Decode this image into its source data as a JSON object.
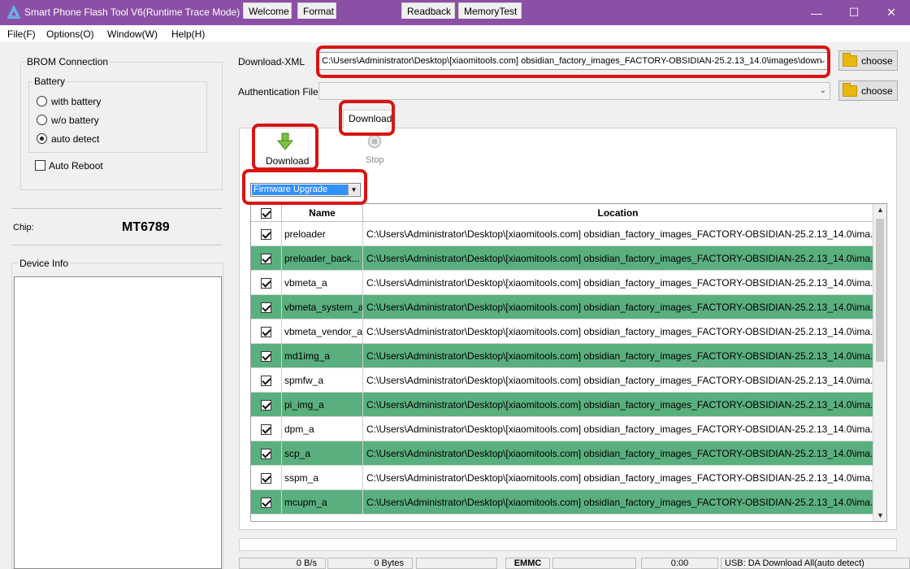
{
  "window": {
    "title": "Smart Phone Flash Tool V6(Runtime Trace Mode)",
    "minimize_glyph": "—",
    "maximize_glyph": "☐",
    "close_glyph": "✕"
  },
  "menu": {
    "items": [
      "File(F)",
      "Options(O)",
      "Window(W)",
      "Help(H)"
    ]
  },
  "left": {
    "brom_label": "BROM Connection",
    "battery_label": "Battery",
    "battery_options": [
      {
        "label": "with battery",
        "checked": false
      },
      {
        "label": "w/o battery",
        "checked": false
      },
      {
        "label": "auto detect",
        "checked": true
      }
    ],
    "auto_reboot_label": "Auto Reboot",
    "auto_reboot_checked": false,
    "chip_label": "Chip:",
    "chip_value": "MT6789",
    "device_info_label": "Device Info"
  },
  "download_xml": {
    "label": "Download-XML",
    "value": "C:\\Users\\Administrator\\Desktop\\[xiaomitools.com] obsidian_factory_images_FACTORY-OBSIDIAN-25.2.13_14.0\\images\\down",
    "choose_label": "choose"
  },
  "auth_file": {
    "label": "Authentication File",
    "value": "",
    "choose_label": "choose"
  },
  "tabs": [
    {
      "label": "Welcome",
      "active": false
    },
    {
      "label": "Format",
      "active": false
    },
    {
      "label": "Download",
      "active": true
    },
    {
      "label": "Readback",
      "active": false
    },
    {
      "label": "MemoryTest",
      "active": false
    }
  ],
  "toolbar": {
    "download_label": "Download",
    "stop_label": "Stop"
  },
  "mode_select": {
    "value": "Firmware Upgrade"
  },
  "table": {
    "headers": {
      "name": "Name",
      "location": "Location"
    },
    "rows": [
      {
        "checked": true,
        "name": "preloader",
        "location": "C:\\Users\\Administrator\\Desktop\\[xiaomitools.com] obsidian_factory_images_FACTORY-OBSIDIAN-25.2.13_14.0\\ima..."
      },
      {
        "checked": true,
        "name": "preloader_back...",
        "location": "C:\\Users\\Administrator\\Desktop\\[xiaomitools.com] obsidian_factory_images_FACTORY-OBSIDIAN-25.2.13_14.0\\ima..."
      },
      {
        "checked": true,
        "name": "vbmeta_a",
        "location": "C:\\Users\\Administrator\\Desktop\\[xiaomitools.com] obsidian_factory_images_FACTORY-OBSIDIAN-25.2.13_14.0\\ima..."
      },
      {
        "checked": true,
        "name": "vbmeta_system_a",
        "location": "C:\\Users\\Administrator\\Desktop\\[xiaomitools.com] obsidian_factory_images_FACTORY-OBSIDIAN-25.2.13_14.0\\ima..."
      },
      {
        "checked": true,
        "name": "vbmeta_vendor_a",
        "location": "C:\\Users\\Administrator\\Desktop\\[xiaomitools.com] obsidian_factory_images_FACTORY-OBSIDIAN-25.2.13_14.0\\ima..."
      },
      {
        "checked": true,
        "name": "md1img_a",
        "location": "C:\\Users\\Administrator\\Desktop\\[xiaomitools.com] obsidian_factory_images_FACTORY-OBSIDIAN-25.2.13_14.0\\ima..."
      },
      {
        "checked": true,
        "name": "spmfw_a",
        "location": "C:\\Users\\Administrator\\Desktop\\[xiaomitools.com] obsidian_factory_images_FACTORY-OBSIDIAN-25.2.13_14.0\\ima..."
      },
      {
        "checked": true,
        "name": "pi_img_a",
        "location": "C:\\Users\\Administrator\\Desktop\\[xiaomitools.com] obsidian_factory_images_FACTORY-OBSIDIAN-25.2.13_14.0\\ima..."
      },
      {
        "checked": true,
        "name": "dpm_a",
        "location": "C:\\Users\\Administrator\\Desktop\\[xiaomitools.com] obsidian_factory_images_FACTORY-OBSIDIAN-25.2.13_14.0\\ima..."
      },
      {
        "checked": true,
        "name": "scp_a",
        "location": "C:\\Users\\Administrator\\Desktop\\[xiaomitools.com] obsidian_factory_images_FACTORY-OBSIDIAN-25.2.13_14.0\\ima..."
      },
      {
        "checked": true,
        "name": "sspm_a",
        "location": "C:\\Users\\Administrator\\Desktop\\[xiaomitools.com] obsidian_factory_images_FACTORY-OBSIDIAN-25.2.13_14.0\\ima..."
      },
      {
        "checked": true,
        "name": "mcupm_a",
        "location": "C:\\Users\\Administrator\\Desktop\\[xiaomitools.com] obsidian_factory_images_FACTORY-OBSIDIAN-25.2.13_14.0\\ima..."
      }
    ]
  },
  "status": {
    "speed": "0 B/s",
    "bytes": "0 Bytes",
    "blank": "",
    "storage": "EMMC",
    "blank2": "",
    "time": "0:00",
    "usb": "USB: DA Download All(auto detect)"
  },
  "colors": {
    "titlebar": "#8c4fa6",
    "alt_row": "#5aaf7e",
    "highlight": "#d81414"
  }
}
